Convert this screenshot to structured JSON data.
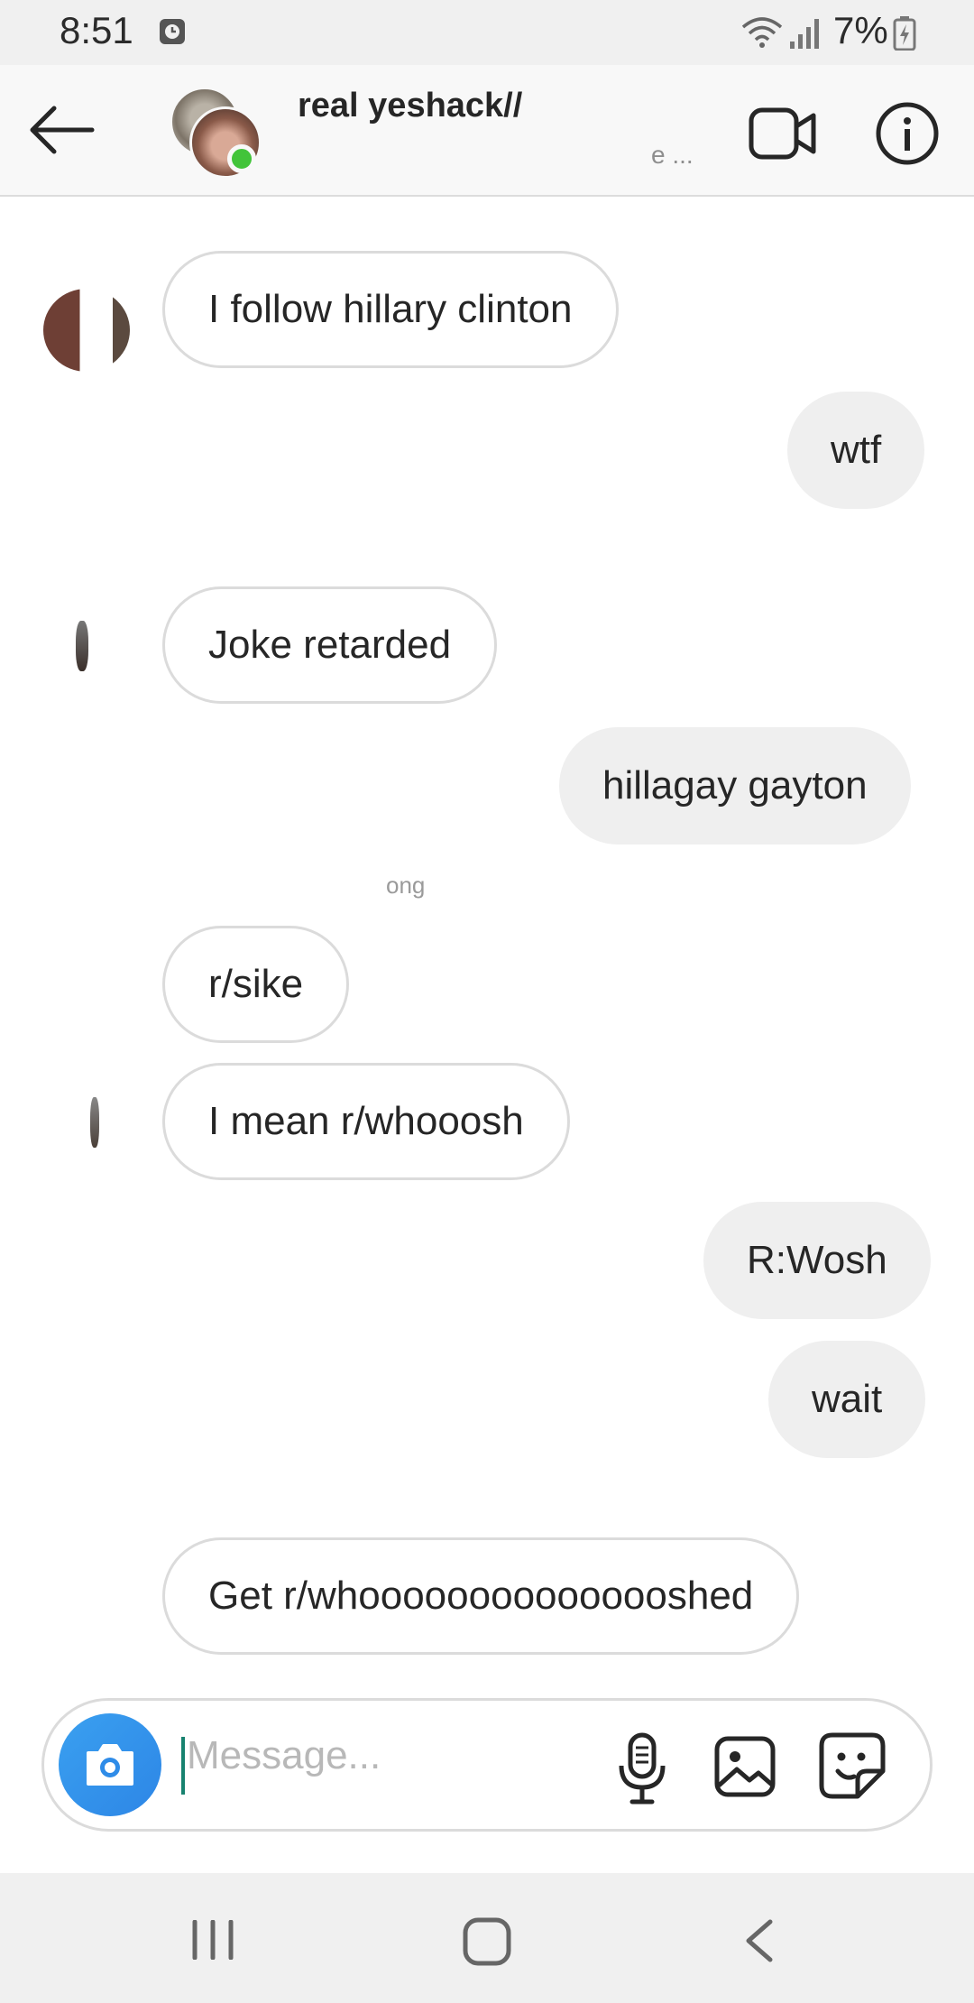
{
  "status_bar": {
    "time": "8:51",
    "battery": "7%"
  },
  "header": {
    "title": "real yeshack//",
    "subtitle": "e ..."
  },
  "messages": [
    {
      "text": "I follow hillary clinton",
      "direction": "in"
    },
    {
      "text": "wtf",
      "direction": "out"
    },
    {
      "text": "Joke retarded",
      "direction": "in"
    },
    {
      "text": "hillagay gayton",
      "direction": "out"
    },
    {
      "text": "r/sike",
      "direction": "in"
    },
    {
      "text": "I mean r/whooosh",
      "direction": "in"
    },
    {
      "text": "R:Wosh",
      "direction": "out"
    },
    {
      "text": "wait",
      "direction": "out"
    },
    {
      "text": "Get r/whooooooooooooooshed",
      "direction": "in"
    }
  ],
  "timestamps": {
    "t2": "ong"
  },
  "composer": {
    "placeholder": "Message..."
  },
  "colors": {
    "accent": "#3897f0",
    "online": "#42c43a",
    "outgoing_bubble": "#efefef",
    "incoming_border": "#dbdbdb"
  }
}
